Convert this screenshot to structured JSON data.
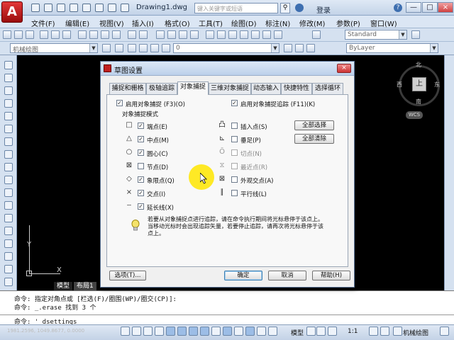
{
  "titlebar": {
    "doc_title": "Drawing1.dwg",
    "search_placeholder": "键入关键字或短语",
    "login": "登录",
    "min": "—",
    "max": "□",
    "close": "×"
  },
  "menubar": {
    "items": [
      "文件(F)",
      "编辑(E)",
      "视图(V)",
      "插入(I)",
      "格式(O)",
      "工具(T)",
      "绘图(D)",
      "标注(N)",
      "修改(M)",
      "参数(P)",
      "窗口(W)"
    ]
  },
  "toolbar1": {
    "style_combo": "Standard"
  },
  "toolbar2": {
    "workspace_combo": "机械绘图",
    "layer_combo": "0",
    "bylayer_combo": "ByLayer"
  },
  "compass": {
    "north": "北",
    "south": "南",
    "west": "西",
    "east": "东",
    "top": "上",
    "wcs": "WCS"
  },
  "ucs": {
    "y": "Y",
    "x": "X"
  },
  "layout_tabs": {
    "model": "模型",
    "layout1": "布局1"
  },
  "command": {
    "line1": "命令: 指定对角点或 [栏选(F)/圈围(WP)/圈交(CP)]:",
    "line2": "命令: _.erase 找到 3 个",
    "prompt": "命令: '_dsettings"
  },
  "statusbar": {
    "coords": "1981.2596, 1049.8677, 0.0000",
    "model": "模型",
    "scale": "1:1",
    "workspace": "机械绘图"
  },
  "dialog": {
    "title": "草图设置",
    "close": "×",
    "tabs": [
      "捕捉和栅格",
      "极轴追踪",
      "对象捕捉",
      "三维对象捕捉",
      "动态输入",
      "快捷特性",
      "选择循环"
    ],
    "active_tab": 2,
    "enable_snap": "启用对象捕捉 (F3)(O)",
    "enable_tracking": "启用对象捕捉追踪 (F11)(K)",
    "mode_group": "对象捕捉模式",
    "left_modes": [
      {
        "label": "端点(E)",
        "checked": true,
        "symbol": "□"
      },
      {
        "label": "中点(M)",
        "checked": true,
        "symbol": "△"
      },
      {
        "label": "圆心(C)",
        "checked": true,
        "symbol": "○"
      },
      {
        "label": "节点(D)",
        "checked": false,
        "symbol": "⊠"
      },
      {
        "label": "象限点(Q)",
        "checked": true,
        "symbol": "◇"
      },
      {
        "label": "交点(I)",
        "checked": true,
        "symbol": "×"
      },
      {
        "label": "延长线(X)",
        "checked": true,
        "symbol": "┄"
      }
    ],
    "right_modes": [
      {
        "label": "插入点(S)",
        "checked": false,
        "symbol": "凸",
        "disabled": false
      },
      {
        "label": "垂足(P)",
        "checked": false,
        "symbol": "⊾",
        "disabled": false
      },
      {
        "label": "切点(N)",
        "checked": false,
        "symbol": "Ō",
        "disabled": true
      },
      {
        "label": "最近点(R)",
        "checked": false,
        "symbol": "⧖",
        "disabled": true
      },
      {
        "label": "外观交点(A)",
        "checked": false,
        "symbol": "⊠",
        "disabled": false
      },
      {
        "label": "平行线(L)",
        "checked": false,
        "symbol": "∥",
        "disabled": false
      }
    ],
    "select_all": "全部选择",
    "clear_all": "全部清除",
    "info": "若要从对象捕捉点进行追踪，请在命令执行期间将光标悬停于该点上。当移动光标时会出现追踪矢量，若要停止追踪，请再次将光标悬停于该点上。",
    "options": "选项(T)...",
    "ok": "确定",
    "cancel": "取消",
    "help": "帮助(H)"
  }
}
